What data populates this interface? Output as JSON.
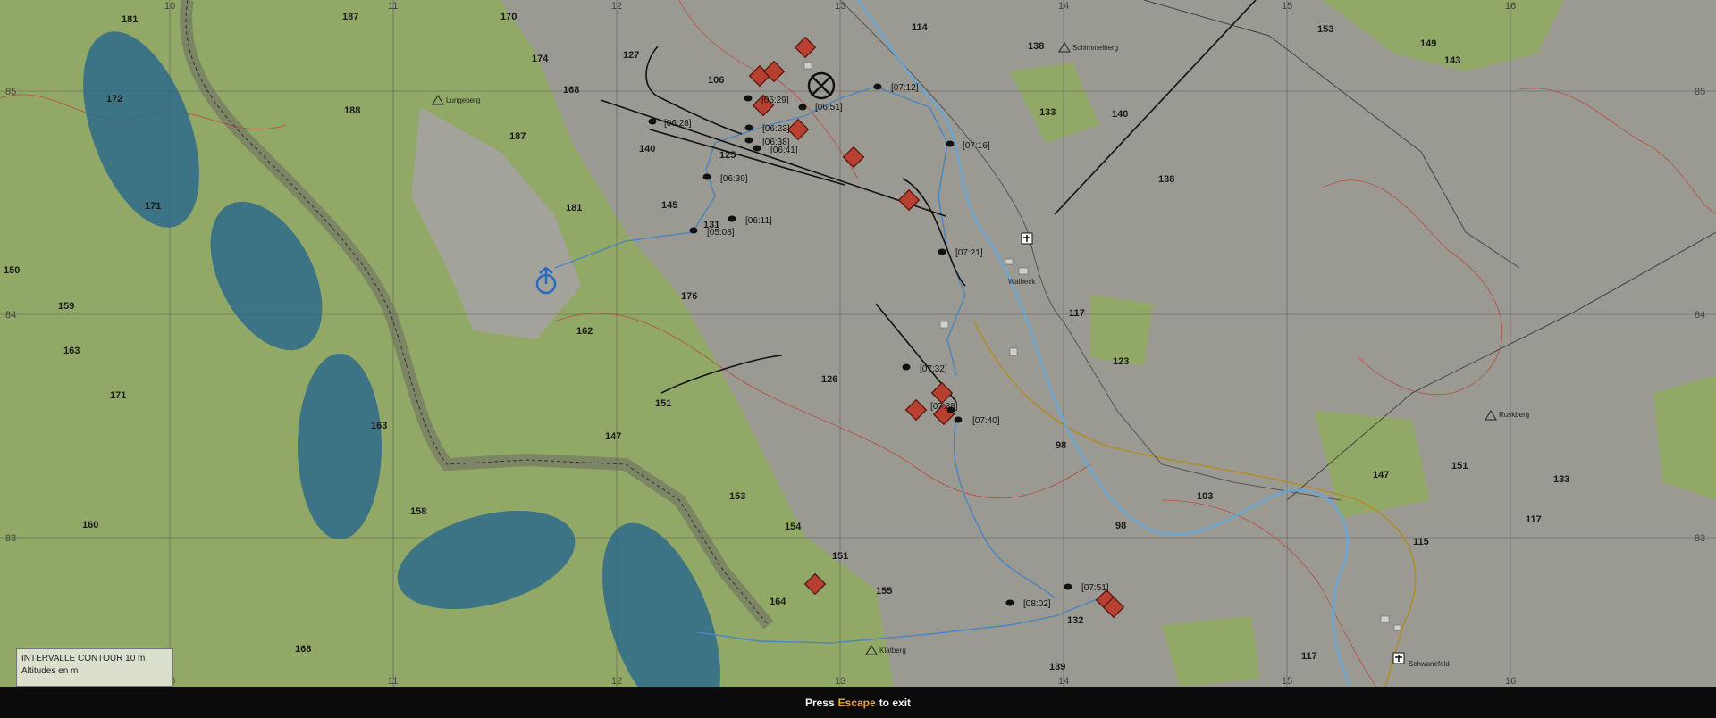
{
  "map": {
    "grid_cols": [
      "10",
      "11",
      "12",
      "13",
      "14",
      "15",
      "16"
    ],
    "grid_rows": [
      "85",
      "84",
      "83"
    ],
    "elevations": [
      "181",
      "187",
      "170",
      "174",
      "127",
      "168",
      "106",
      "114",
      "138",
      "153",
      "149",
      "143",
      "172",
      "188",
      "187",
      "140",
      "125",
      "133",
      "140",
      "138",
      "171",
      "181",
      "145",
      "131",
      "150",
      "159",
      "176",
      "162",
      "117",
      "163",
      "126",
      "123",
      "171",
      "151",
      "147",
      "163",
      "98",
      "158",
      "153",
      "103",
      "160",
      "154",
      "98",
      "147",
      "151",
      "133",
      "117",
      "115",
      "151",
      "155",
      "164",
      "132",
      "168",
      "117",
      "139"
    ],
    "times": [
      "[06:29]",
      "[06:51]",
      "[07:12]",
      "[06:28]",
      "[06:23]",
      "[06:38]",
      "[06:41]",
      "[07:16]",
      "[06:39]",
      "[06:11]",
      "[05:08]",
      "[07:21]",
      "[07:32]",
      "[07:38]",
      "[07:40]",
      "[07:51]",
      "[08:02]"
    ],
    "places": [
      "Lungeberg",
      "Schimmelberg",
      "Walbeck",
      "Ruskberg",
      "Klatberg",
      "Schwanefeld"
    ]
  },
  "legend": {
    "title": "INTERVALLE CONTOUR 10 m",
    "subtitle": "Altitudes en m"
  },
  "footer": {
    "prefix": "Press",
    "key": "Escape",
    "suffix": "to exit"
  },
  "colors": {
    "green": "#92a866",
    "grey": "#9a9a92",
    "blue_zone": "#2e6a8c",
    "enemy": "#b84030",
    "route": "#4a86c0",
    "key_accent": "#f0a23a"
  }
}
